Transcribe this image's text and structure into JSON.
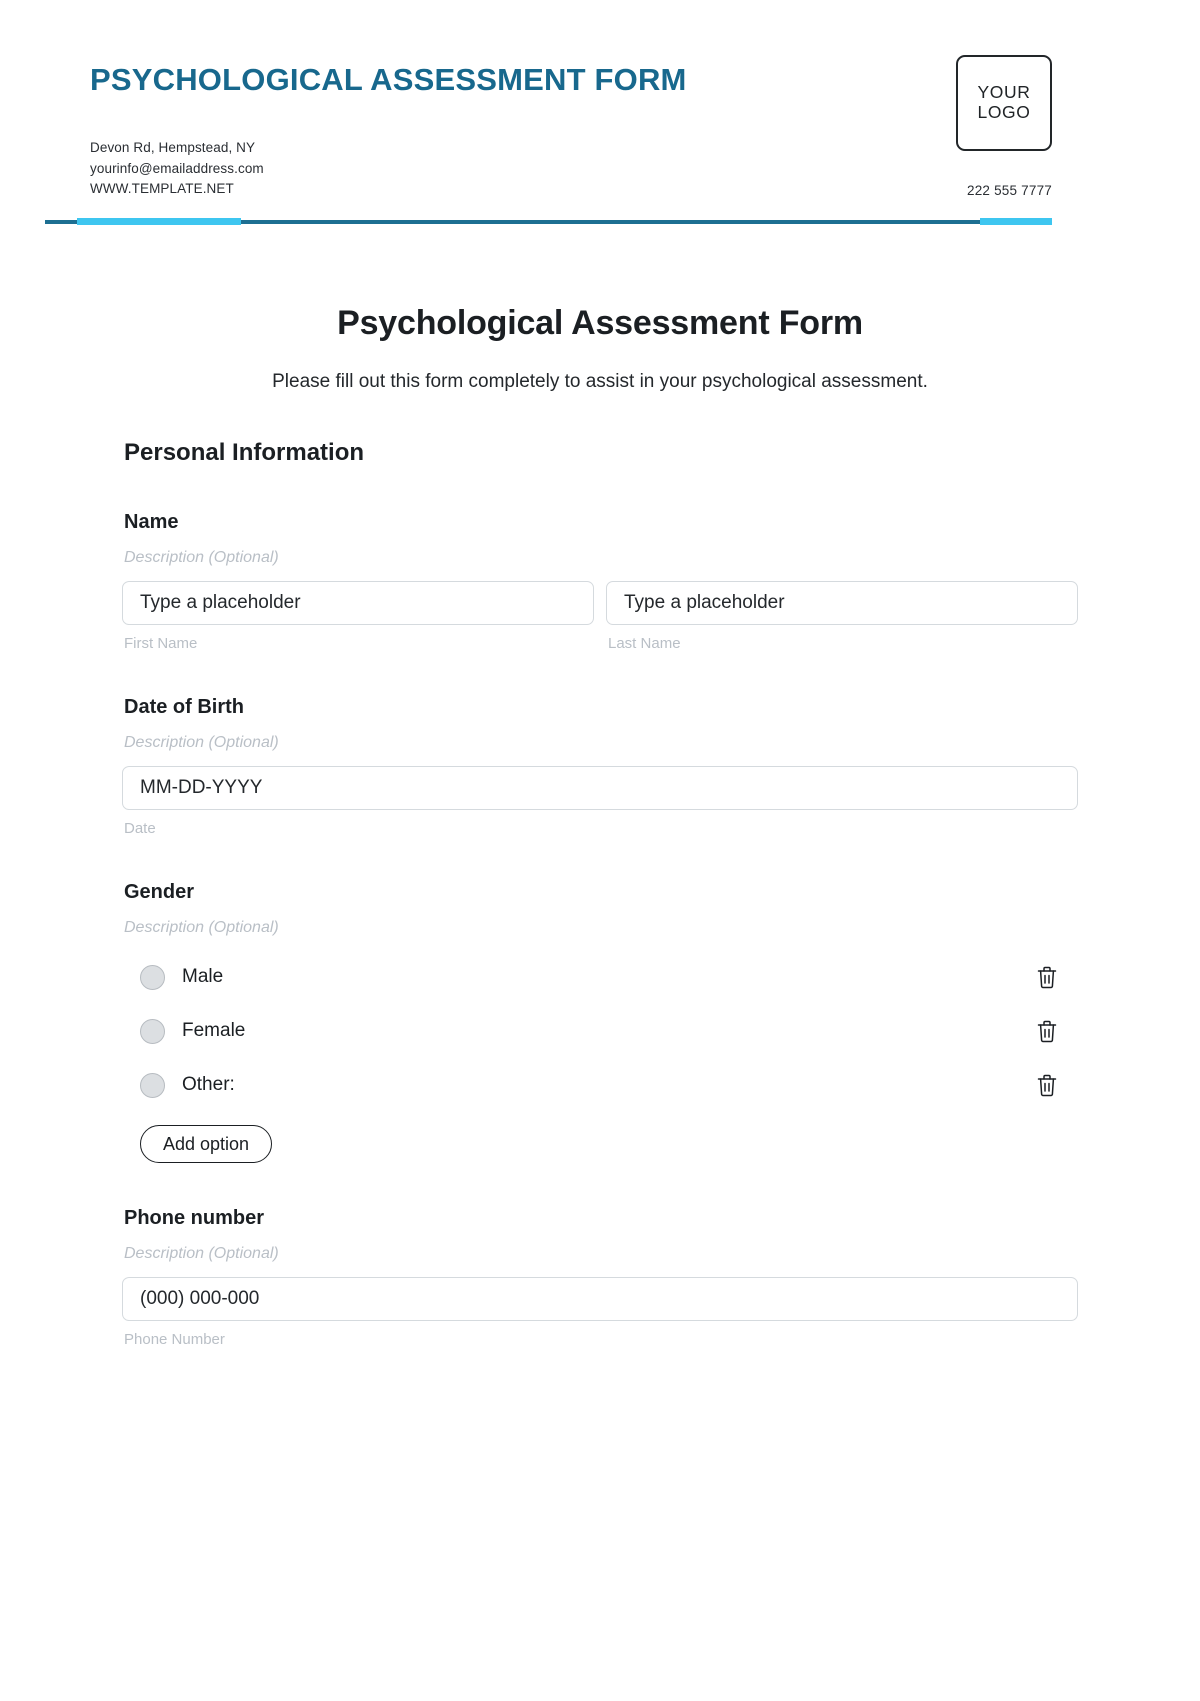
{
  "letterhead": {
    "title": "PSYCHOLOGICAL ASSESSMENT FORM",
    "address": "Devon Rd, Hempstead, NY",
    "email": "yourinfo@emailaddress.com",
    "website": "WWW.TEMPLATE.NET",
    "phone": "222 555 7777",
    "logo_line1": "YOUR",
    "logo_line2": "LOGO",
    "accent_dark": "#1d6f92",
    "accent_light": "#3ec6f0",
    "title_color": "#18688d"
  },
  "form": {
    "title": "Psychological Assessment Form",
    "subtitle": "Please fill out this form completely to assist in your psychological assessment.",
    "section_heading": "Personal Information",
    "description_optional": "Description (Optional)",
    "name": {
      "label": "Name",
      "description": "Description (Optional)",
      "first": {
        "placeholder": "Type a placeholder",
        "value": "",
        "sub_label": "First Name"
      },
      "last": {
        "placeholder": "Type a placeholder",
        "value": "",
        "sub_label": "Last Name"
      }
    },
    "dob": {
      "label": "Date of Birth",
      "description": "Description (Optional)",
      "placeholder": "MM-DD-YYYY",
      "value": "",
      "sub_label": "Date"
    },
    "gender": {
      "label": "Gender",
      "description": "Description (Optional)",
      "options": [
        {
          "label": "Male",
          "delete_icon": "trash-icon"
        },
        {
          "label": "Female",
          "delete_icon": "trash-icon"
        },
        {
          "label": "Other:",
          "delete_icon": "trash-icon"
        }
      ],
      "add_option_label": "Add option"
    },
    "phone": {
      "label": "Phone number",
      "description": "Description (Optional)",
      "placeholder": "(000) 000-000",
      "value": "",
      "sub_label": "Phone Number"
    }
  }
}
